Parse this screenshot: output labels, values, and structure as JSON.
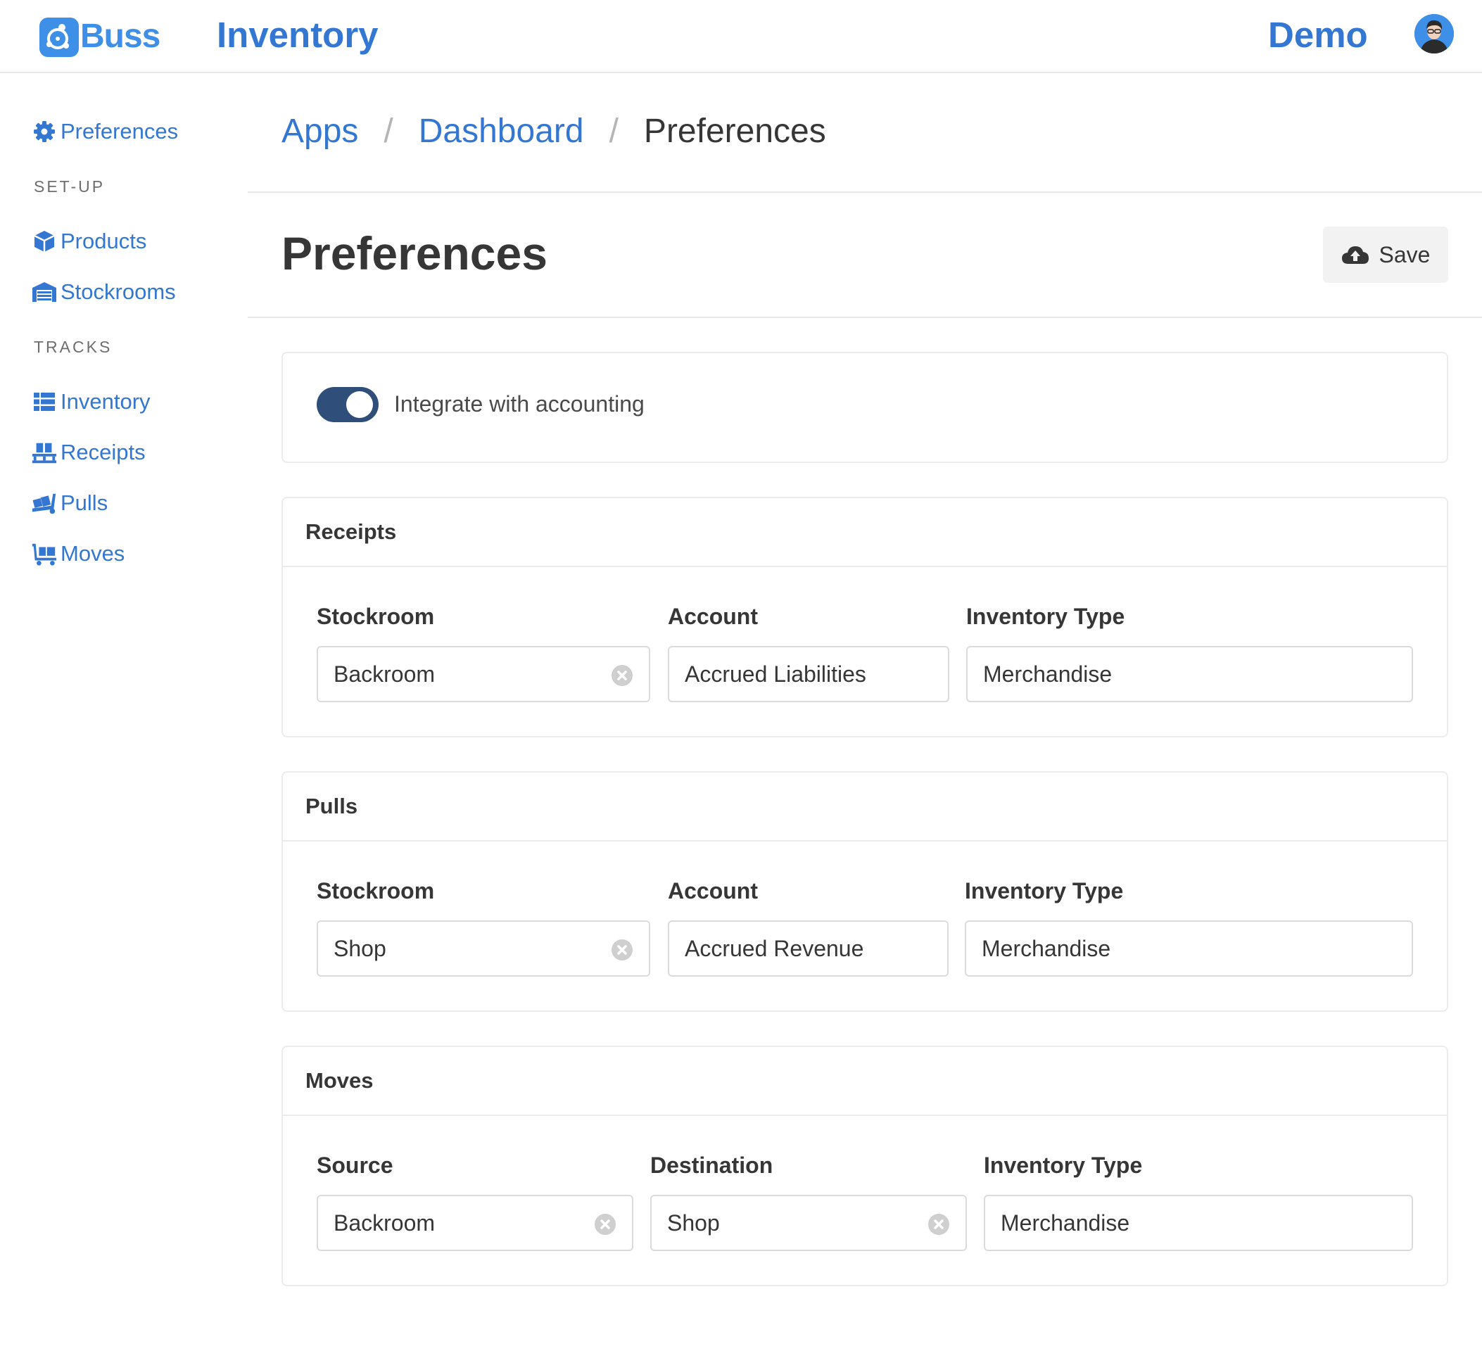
{
  "header": {
    "logo_text": "Buss",
    "app_title": "Inventory",
    "user_name": "Demo"
  },
  "sidebar": {
    "preferences": "Preferences",
    "setup_heading": "SET-UP",
    "setup_items": [
      "Products",
      "Stockrooms"
    ],
    "tracks_heading": "TRACKS",
    "tracks_items": [
      "Inventory",
      "Receipts",
      "Pulls",
      "Moves"
    ]
  },
  "breadcrumb": {
    "items": [
      "Apps",
      "Dashboard"
    ],
    "separator": "/",
    "current": "Preferences"
  },
  "page": {
    "title": "Preferences",
    "save_label": "Save"
  },
  "accounting": {
    "label": "Integrate with accounting",
    "enabled": true
  },
  "receipts": {
    "title": "Receipts",
    "labels": [
      "Stockroom",
      "Account",
      "Inventory Type"
    ],
    "values": [
      "Backroom",
      "Accrued Liabilities",
      "Merchandise"
    ]
  },
  "pulls": {
    "title": "Pulls",
    "labels": [
      "Stockroom",
      "Account",
      "Inventory Type"
    ],
    "values": [
      "Shop",
      "Accrued Revenue",
      "Merchandise"
    ]
  },
  "moves": {
    "title": "Moves",
    "labels": [
      "Source",
      "Destination",
      "Inventory Type"
    ],
    "values": [
      "Backroom",
      "Shop",
      "Merchandise"
    ]
  },
  "colors": {
    "accent": "#3477d3",
    "logo": "#3d8fe8",
    "toggle_on": "#2f4f7a",
    "border": "#dbdbdb"
  },
  "icons": {
    "preferences": "gear-icon",
    "products": "cube-icon",
    "stockrooms": "warehouse-icon",
    "inventory": "list-icon",
    "receipts": "pallet-icon",
    "pulls": "dolly-icon",
    "moves": "cart-flatbed-icon",
    "save": "cloud-upload-icon",
    "clear": "times-circle-icon"
  }
}
